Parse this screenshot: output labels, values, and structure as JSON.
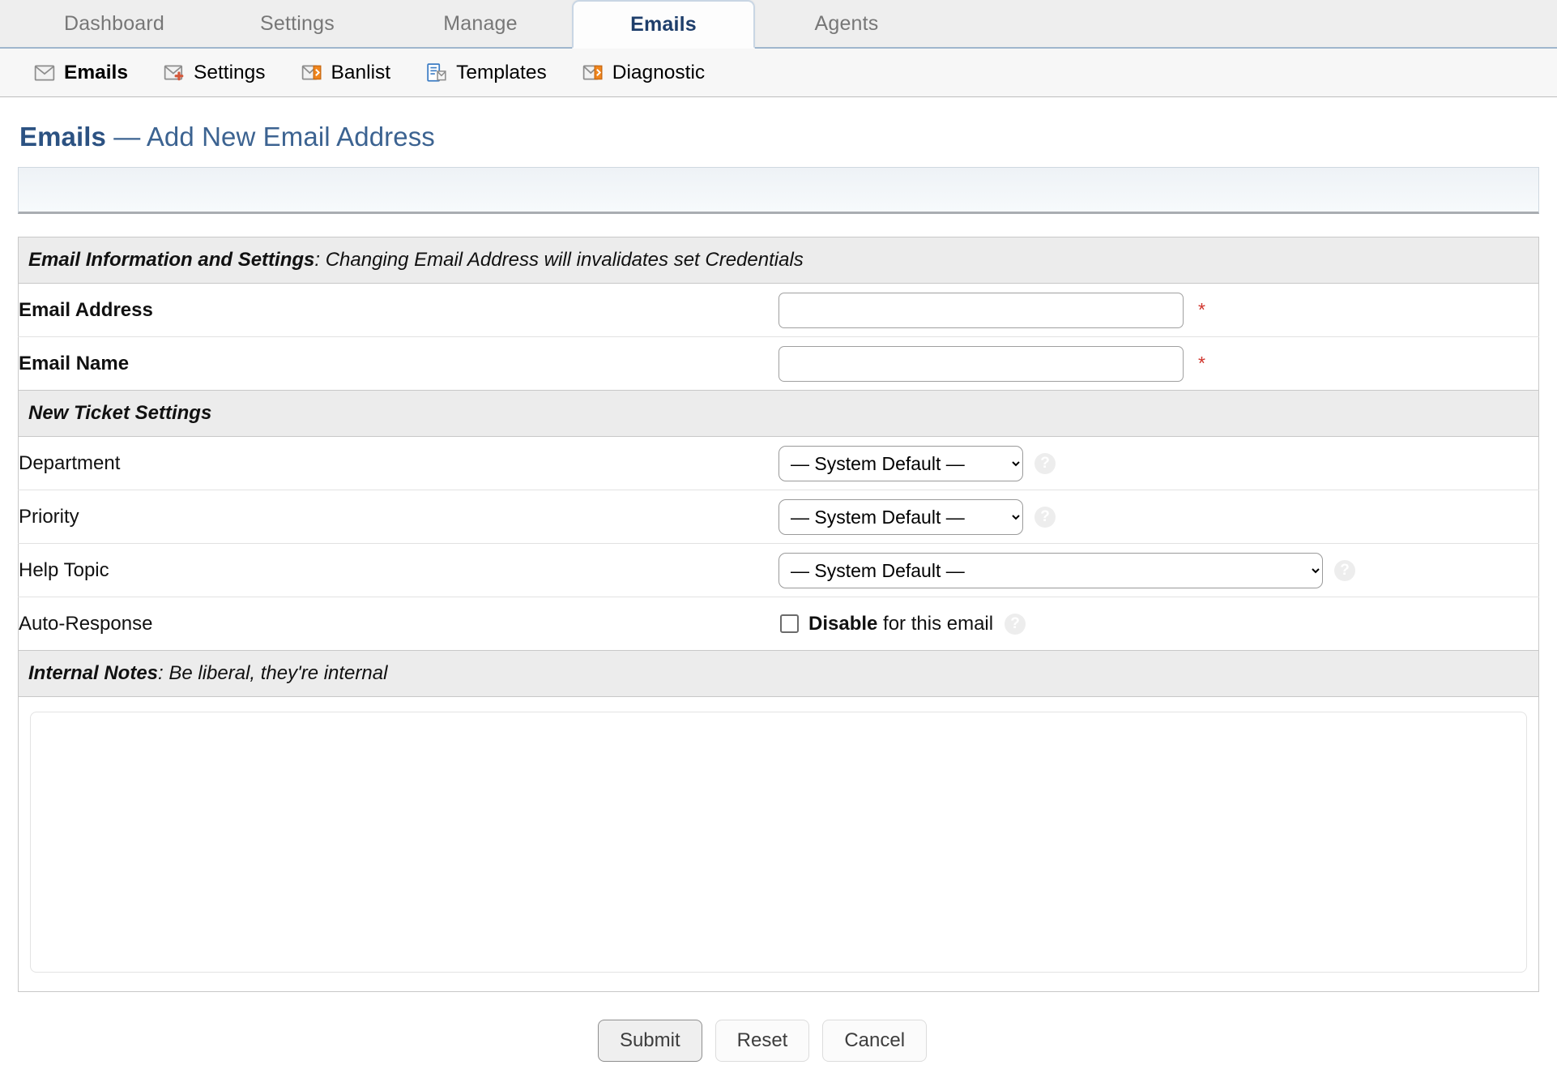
{
  "tabs": [
    {
      "label": "Dashboard",
      "active": false
    },
    {
      "label": "Settings",
      "active": false
    },
    {
      "label": "Manage",
      "active": false
    },
    {
      "label": "Emails",
      "active": true
    },
    {
      "label": "Agents",
      "active": false
    }
  ],
  "subnav": [
    {
      "label": "Emails",
      "icon": "envelope-icon",
      "selected": true
    },
    {
      "label": "Settings",
      "icon": "envelope-settings-icon",
      "selected": false
    },
    {
      "label": "Banlist",
      "icon": "envelope-arrow-icon",
      "selected": false
    },
    {
      "label": "Templates",
      "icon": "document-envelope-icon",
      "selected": false
    },
    {
      "label": "Diagnostic",
      "icon": "envelope-arrow-icon",
      "selected": false
    }
  ],
  "page": {
    "title_strong": "Emails",
    "title_rest": " — Add New Email Address"
  },
  "banner": {
    "text": ""
  },
  "sections": {
    "email_info": {
      "heading": "Email Information and Settings",
      "description": ": Changing Email Address will invalidates set Credentials"
    },
    "ticket_settings": {
      "heading": "New Ticket Settings",
      "description": ""
    },
    "internal_notes": {
      "heading": "Internal Notes",
      "description": ": Be liberal, they're internal"
    }
  },
  "fields": {
    "email_address": {
      "label": "Email Address",
      "value": "",
      "placeholder": "",
      "required_marker": "*"
    },
    "email_name": {
      "label": "Email Name",
      "value": "",
      "placeholder": "",
      "required_marker": "*"
    },
    "department": {
      "label": "Department",
      "value": "— System Default —",
      "options": [
        "— System Default —"
      ]
    },
    "priority": {
      "label": "Priority",
      "value": "— System Default —",
      "options": [
        "— System Default —"
      ]
    },
    "help_topic": {
      "label": "Help Topic",
      "value": "— System Default —",
      "options": [
        "— System Default —"
      ]
    },
    "auto_response": {
      "label": "Auto-Response",
      "checked": false,
      "strong_text": "Disable",
      "rest_text": " for this email"
    },
    "notes": {
      "value": "",
      "placeholder": ""
    }
  },
  "help_glyph": "?",
  "buttons": {
    "submit": "Submit",
    "reset": "Reset",
    "cancel": "Cancel"
  },
  "colors": {
    "accent_blue": "#2c5282",
    "tab_active_text": "#1e3e6b",
    "required_red": "#d0342c",
    "section_bg": "#ececec",
    "banner_bg": "#eef2f6"
  }
}
